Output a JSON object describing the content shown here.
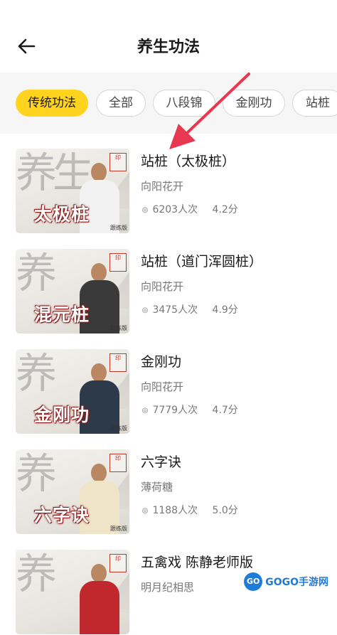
{
  "header": {
    "title": "养生功法"
  },
  "tabs": [
    {
      "label": "传统功法",
      "active": true
    },
    {
      "label": "全部"
    },
    {
      "label": "八段锦"
    },
    {
      "label": "金刚功"
    },
    {
      "label": "站桩"
    }
  ],
  "items": [
    {
      "name": "站桩（太极桩）",
      "author": "向阳花开",
      "views": "6203人次",
      "score": "4.2分",
      "thumb_caption": "太极桩",
      "thumb_bg": "养生",
      "outfit_color": "#f2f2f2"
    },
    {
      "name": "站桩（道门浑圆桩）",
      "author": "向阳花开",
      "views": "3475人次",
      "score": "4.9分",
      "thumb_caption": "混元桩",
      "thumb_bg": "养",
      "outfit_color": "#3a3a3a"
    },
    {
      "name": "金刚功",
      "author": "向阳花开",
      "views": "7779人次",
      "score": "4.7分",
      "thumb_caption": "金刚功",
      "thumb_bg": "养",
      "outfit_color": "#2d3a4a"
    },
    {
      "name": "六字诀",
      "author": "薄荷糖",
      "views": "1188人次",
      "score": "5.0分",
      "thumb_caption": "六字诀",
      "thumb_bg": "养",
      "outfit_color": "#efe3c8"
    },
    {
      "name": "五禽戏 陈静老师版",
      "author": "明月纪相思",
      "views": "",
      "score": "",
      "thumb_caption": "",
      "thumb_bg": "养",
      "outfit_color": "#c0282d"
    }
  ],
  "thumb_tag": "跟练版",
  "watermark": {
    "text": "GOGO手游网",
    "logo": "GO"
  },
  "colors": {
    "accent": "#ffd31e",
    "arrow": "#e8384f"
  }
}
